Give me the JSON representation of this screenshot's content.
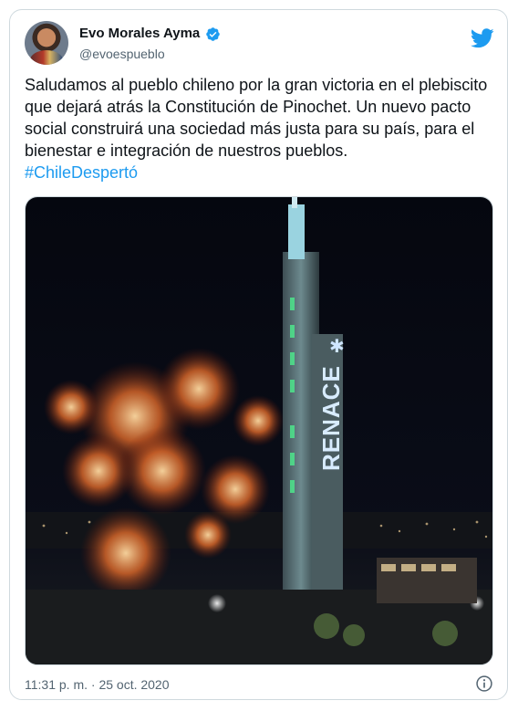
{
  "tweet": {
    "author_name": "Evo Morales Ayma",
    "handle": "@evoespueblo",
    "text": "Saludamos al pueblo chileno por la gran victoria en el plebiscito que dejará atrás la Constitución de Pinochet. Un nuevo pacto social construirá una sociedad más justa para su país, para el bienestar e integración de nuestros pueblos.",
    "hashtag": "#ChileDespertó",
    "timestamp": "11:31 p. m. · 25 oct. 2020"
  },
  "media": {
    "tower_sign": "RENACE"
  },
  "icons": {
    "verified": "verified-badge-icon",
    "brand": "twitter-bird-icon",
    "info": "info-icon"
  },
  "colors": {
    "link": "#1d9bf0",
    "verified": "#1d9bf0",
    "brand": "#1d9bf0",
    "muted": "#536471"
  }
}
